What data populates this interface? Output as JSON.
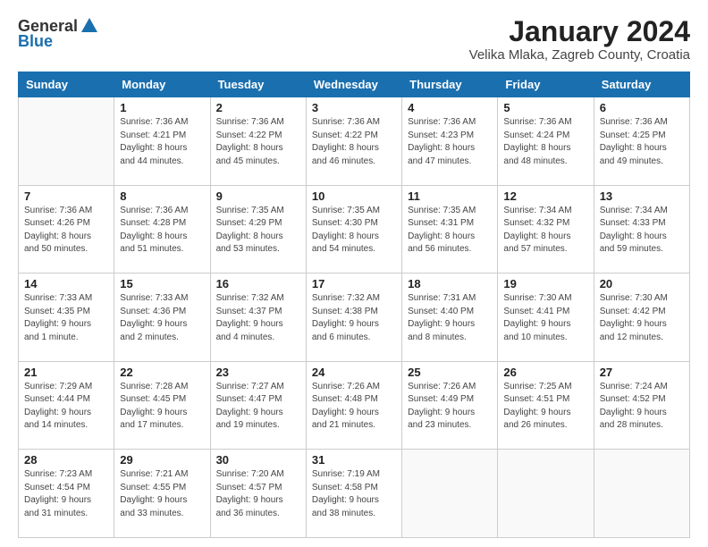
{
  "header": {
    "logo_general": "General",
    "logo_blue": "Blue",
    "month_title": "January 2024",
    "location": "Velika Mlaka, Zagreb County, Croatia"
  },
  "days_of_week": [
    "Sunday",
    "Monday",
    "Tuesday",
    "Wednesday",
    "Thursday",
    "Friday",
    "Saturday"
  ],
  "weeks": [
    [
      {
        "num": "",
        "info": ""
      },
      {
        "num": "1",
        "info": "Sunrise: 7:36 AM\nSunset: 4:21 PM\nDaylight: 8 hours\nand 44 minutes."
      },
      {
        "num": "2",
        "info": "Sunrise: 7:36 AM\nSunset: 4:22 PM\nDaylight: 8 hours\nand 45 minutes."
      },
      {
        "num": "3",
        "info": "Sunrise: 7:36 AM\nSunset: 4:22 PM\nDaylight: 8 hours\nand 46 minutes."
      },
      {
        "num": "4",
        "info": "Sunrise: 7:36 AM\nSunset: 4:23 PM\nDaylight: 8 hours\nand 47 minutes."
      },
      {
        "num": "5",
        "info": "Sunrise: 7:36 AM\nSunset: 4:24 PM\nDaylight: 8 hours\nand 48 minutes."
      },
      {
        "num": "6",
        "info": "Sunrise: 7:36 AM\nSunset: 4:25 PM\nDaylight: 8 hours\nand 49 minutes."
      }
    ],
    [
      {
        "num": "7",
        "info": "Sunrise: 7:36 AM\nSunset: 4:26 PM\nDaylight: 8 hours\nand 50 minutes."
      },
      {
        "num": "8",
        "info": "Sunrise: 7:36 AM\nSunset: 4:28 PM\nDaylight: 8 hours\nand 51 minutes."
      },
      {
        "num": "9",
        "info": "Sunrise: 7:35 AM\nSunset: 4:29 PM\nDaylight: 8 hours\nand 53 minutes."
      },
      {
        "num": "10",
        "info": "Sunrise: 7:35 AM\nSunset: 4:30 PM\nDaylight: 8 hours\nand 54 minutes."
      },
      {
        "num": "11",
        "info": "Sunrise: 7:35 AM\nSunset: 4:31 PM\nDaylight: 8 hours\nand 56 minutes."
      },
      {
        "num": "12",
        "info": "Sunrise: 7:34 AM\nSunset: 4:32 PM\nDaylight: 8 hours\nand 57 minutes."
      },
      {
        "num": "13",
        "info": "Sunrise: 7:34 AM\nSunset: 4:33 PM\nDaylight: 8 hours\nand 59 minutes."
      }
    ],
    [
      {
        "num": "14",
        "info": "Sunrise: 7:33 AM\nSunset: 4:35 PM\nDaylight: 9 hours\nand 1 minute."
      },
      {
        "num": "15",
        "info": "Sunrise: 7:33 AM\nSunset: 4:36 PM\nDaylight: 9 hours\nand 2 minutes."
      },
      {
        "num": "16",
        "info": "Sunrise: 7:32 AM\nSunset: 4:37 PM\nDaylight: 9 hours\nand 4 minutes."
      },
      {
        "num": "17",
        "info": "Sunrise: 7:32 AM\nSunset: 4:38 PM\nDaylight: 9 hours\nand 6 minutes."
      },
      {
        "num": "18",
        "info": "Sunrise: 7:31 AM\nSunset: 4:40 PM\nDaylight: 9 hours\nand 8 minutes."
      },
      {
        "num": "19",
        "info": "Sunrise: 7:30 AM\nSunset: 4:41 PM\nDaylight: 9 hours\nand 10 minutes."
      },
      {
        "num": "20",
        "info": "Sunrise: 7:30 AM\nSunset: 4:42 PM\nDaylight: 9 hours\nand 12 minutes."
      }
    ],
    [
      {
        "num": "21",
        "info": "Sunrise: 7:29 AM\nSunset: 4:44 PM\nDaylight: 9 hours\nand 14 minutes."
      },
      {
        "num": "22",
        "info": "Sunrise: 7:28 AM\nSunset: 4:45 PM\nDaylight: 9 hours\nand 17 minutes."
      },
      {
        "num": "23",
        "info": "Sunrise: 7:27 AM\nSunset: 4:47 PM\nDaylight: 9 hours\nand 19 minutes."
      },
      {
        "num": "24",
        "info": "Sunrise: 7:26 AM\nSunset: 4:48 PM\nDaylight: 9 hours\nand 21 minutes."
      },
      {
        "num": "25",
        "info": "Sunrise: 7:26 AM\nSunset: 4:49 PM\nDaylight: 9 hours\nand 23 minutes."
      },
      {
        "num": "26",
        "info": "Sunrise: 7:25 AM\nSunset: 4:51 PM\nDaylight: 9 hours\nand 26 minutes."
      },
      {
        "num": "27",
        "info": "Sunrise: 7:24 AM\nSunset: 4:52 PM\nDaylight: 9 hours\nand 28 minutes."
      }
    ],
    [
      {
        "num": "28",
        "info": "Sunrise: 7:23 AM\nSunset: 4:54 PM\nDaylight: 9 hours\nand 31 minutes."
      },
      {
        "num": "29",
        "info": "Sunrise: 7:21 AM\nSunset: 4:55 PM\nDaylight: 9 hours\nand 33 minutes."
      },
      {
        "num": "30",
        "info": "Sunrise: 7:20 AM\nSunset: 4:57 PM\nDaylight: 9 hours\nand 36 minutes."
      },
      {
        "num": "31",
        "info": "Sunrise: 7:19 AM\nSunset: 4:58 PM\nDaylight: 9 hours\nand 38 minutes."
      },
      {
        "num": "",
        "info": ""
      },
      {
        "num": "",
        "info": ""
      },
      {
        "num": "",
        "info": ""
      }
    ]
  ]
}
